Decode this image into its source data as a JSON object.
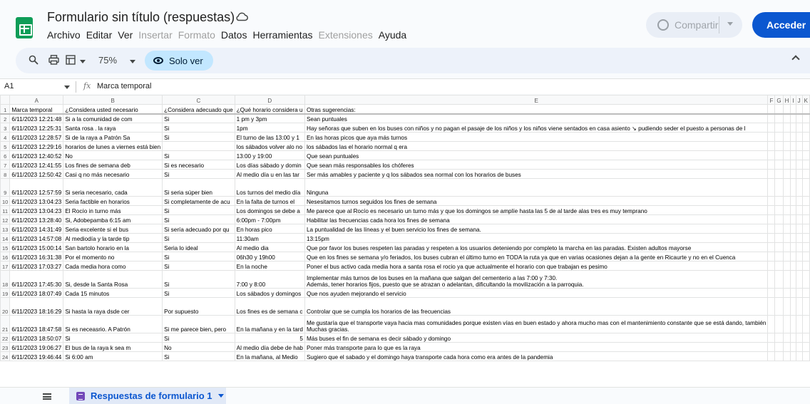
{
  "app": {
    "title": "Formulario sin título (respuestas)",
    "menus": [
      {
        "label": "Archivo",
        "disabled": false
      },
      {
        "label": "Editar",
        "disabled": false
      },
      {
        "label": "Ver",
        "disabled": false
      },
      {
        "label": "Insertar",
        "disabled": true
      },
      {
        "label": "Formato",
        "disabled": true
      },
      {
        "label": "Datos",
        "disabled": false
      },
      {
        "label": "Herramientas",
        "disabled": false
      },
      {
        "label": "Extensiones",
        "disabled": true
      },
      {
        "label": "Ayuda",
        "disabled": false
      }
    ],
    "share_label": "Compartir",
    "signin_label": "Acceder"
  },
  "toolbar": {
    "zoom": "75%",
    "view_only_label": "Solo ver"
  },
  "formula_bar": {
    "cell_ref": "A1",
    "fx": "fx",
    "content": "Marca temporal"
  },
  "grid": {
    "columns": [
      "A",
      "B",
      "C",
      "D",
      "E",
      "F",
      "G",
      "H",
      "I",
      "J",
      "K"
    ],
    "rows": [
      {
        "n": "1",
        "cells": [
          "Marca temporal",
          "¿Considera usted necesario",
          "¿Considera adecuado que",
          "¿Qué horario considera u",
          "Otras sugerencias:"
        ],
        "header": true
      },
      {
        "n": "2",
        "cells": [
          "6/11/2023 12:21:48",
          "Si a la comunidad de com",
          "Si",
          "1 pm y 3pm",
          "Sean puntuales"
        ]
      },
      {
        "n": "3",
        "cells": [
          "6/11/2023 12:25:31",
          "   Santa rosa  . la  raya",
          "Si",
          "1pm",
          "Hay señoras que suben en los buses con niños   y no pagan el pasaje de los niños y  los niños viene sentados  en casa asiento  ↘     pudiendo seder  el puesto a personas de l"
        ]
      },
      {
        "n": "4",
        "cells": [
          "6/11/2023 12:28:57",
          "Si de la raya a Patrón Sa",
          "Si",
          "El turno de las  13:00 y 1",
          "En las horas picos que aya más turnos"
        ]
      },
      {
        "n": "5",
        "cells": [
          "6/11/2023 12:29:16",
          "horarios de lunes a viernes está bien",
          "",
          "los sábados volver alo no",
          "los sábados las el horario normal q era"
        ]
      },
      {
        "n": "6",
        "cells": [
          "6/11/2023 12:40:52",
          "No",
          "Si",
          "13:00 y 19:00",
          "Que sean puntuales"
        ]
      },
      {
        "n": "7",
        "cells": [
          "6/11/2023 12:41:55",
          "Los fines de semana deb",
          "Si es necesario",
          "Los días sábado y domin",
          "Que sean más responsables los chóferes"
        ]
      },
      {
        "n": "8",
        "cells": [
          "6/11/2023 12:50:42",
          "Casi q no más necesario",
          "Si",
          "Al medio  día u en las tar",
          "Ser más amables y paciente  y q los sábados sea normal con los horarios de buses"
        ]
      },
      {
        "n": "9",
        "cells": [
          "6/11/2023 12:57:59",
          "Si seria necesario, cada",
          "Si seria súper bien",
          "Los turnos del medio día",
          "Ninguna"
        ],
        "tall": true
      },
      {
        "n": "10",
        "cells": [
          "6/11/2023 13:04:23",
          " Seria factible en horarios",
          "Si completamente de acu",
          "  En la falta de turnos  el",
          "Nesesitamos turnos seguidos los fines de semana"
        ]
      },
      {
        "n": "11",
        "cells": [
          "6/11/2023 13:04:23",
          "El Rocío in turno más",
          "Si",
          "Los domingos se debe a",
          "Me parece que al Rocío es necesario un turno más y que los domingos se amplíe hasta las 5 de al tarde alas tres es muy temprano"
        ]
      },
      {
        "n": "12",
        "cells": [
          "6/11/2023 13:28:40",
          "Si, Adobepamba 6:15 am",
          "Si",
          "6:00pm - 7:00pm",
          "Habilitar las frecuencias cada hora los fines de semana"
        ]
      },
      {
        "n": "13",
        "cells": [
          "6/11/2023 14:31:49",
          "Seria excelente si el bus",
          "Si sería adecuado por qu",
          "En horas pico",
          "La puntualidad de las líneas y el buen servicio los fines de semana."
        ]
      },
      {
        "n": "14",
        "cells": [
          "6/11/2023 14:57:08",
          "Al mediodía y la tarde tip",
          "Si",
          "11:30am",
          "13:15pm"
        ]
      },
      {
        "n": "15",
        "cells": [
          "6/11/2023 15:00:14",
          "San bartolo horario en la",
          "Seria lo ideal",
          "Al medio dia",
          "Que por favor los buses respeten las paradas y respeten a los usuarios deteniendo por completo la marcha en las paradas. Existen adultos mayorse"
        ]
      },
      {
        "n": "16",
        "cells": [
          "6/11/2023 16:31:38",
          "Por el momento no",
          "Si",
          "06h30 y 19h00",
          "Que en los fines se semana y/o feriados, los buses cubran el último turno en TODA la ruta ya que en varias ocasiones dejan a la gente en Ricaurte y no en el Cuenca"
        ]
      },
      {
        "n": "17",
        "cells": [
          "6/11/2023 17:03:27",
          "Cada media hora  como",
          "Si",
          "En la noche",
          "Poner el bus activo  cada media hora  a santa rosa  el rocio   ya que actualmente el horario con que trabajan es pesimo"
        ]
      },
      {
        "n": "18",
        "cells": [
          "6/11/2023 17:45:30",
          "Si, desde la Santa Rosa",
          "Si",
          "7:00 y 8:00",
          "Implementar más turnos de los buses en la mañana que salgan del cementerio a las 7:00 y 7:30.|Además, tener horarios fijos, puesto que se atrazan o adelantan, dificultando la movilización a la parroquia."
        ],
        "tall": true
      },
      {
        "n": "19",
        "cells": [
          "6/11/2023 18:07:49",
          "Cada 15 minutos",
          "Si",
          "Los sábados y domingos",
          "Que nos ayuden mejorando el servicio"
        ]
      },
      {
        "n": "20",
        "cells": [
          "6/11/2023 18:16:29",
          "Si hasta la raya dsde cer",
          "Por supuesto",
          "Los fines es de semana c",
          "Controlar que se cumpla los horarios de las frecuencias"
        ],
        "tall": true
      },
      {
        "n": "21",
        "cells": [
          "6/11/2023 18:47:58",
          "Si es neceasrio. A Patrón",
          "Si me parece bien, pero",
          "En la mañana y en la tard",
          "Me gustaría que el transporte vaya hacia mas comunidades porque existen vías en buen estado y ahora mucho mas con el mantenimiento constante que se está dando, también|Muchas gracias."
        ],
        "tall": true
      },
      {
        "n": "22",
        "cells": [
          "6/11/2023 18:50:07",
          "Si",
          "Si",
          "5",
          "Más buses el fin de semana es decir sábado y domingo"
        ]
      },
      {
        "n": "23",
        "cells": [
          "6/11/2023 19:06:27",
          "El bus de la raya k sea m",
          "No",
          "Al medio día debe de hab",
          "Poner más transporte para lo que es la raya"
        ]
      },
      {
        "n": "24",
        "cells": [
          "6/11/2023 19:46:44",
          "Si 6:00 am",
          "Si",
          "En la mañana, al Medio",
          "Sugiero que el sabado y el domingo haya transporte cada hora como era antes de la pandemia"
        ]
      }
    ]
  },
  "bottom": {
    "sheet_tab": "Respuestas de formulario 1"
  }
}
